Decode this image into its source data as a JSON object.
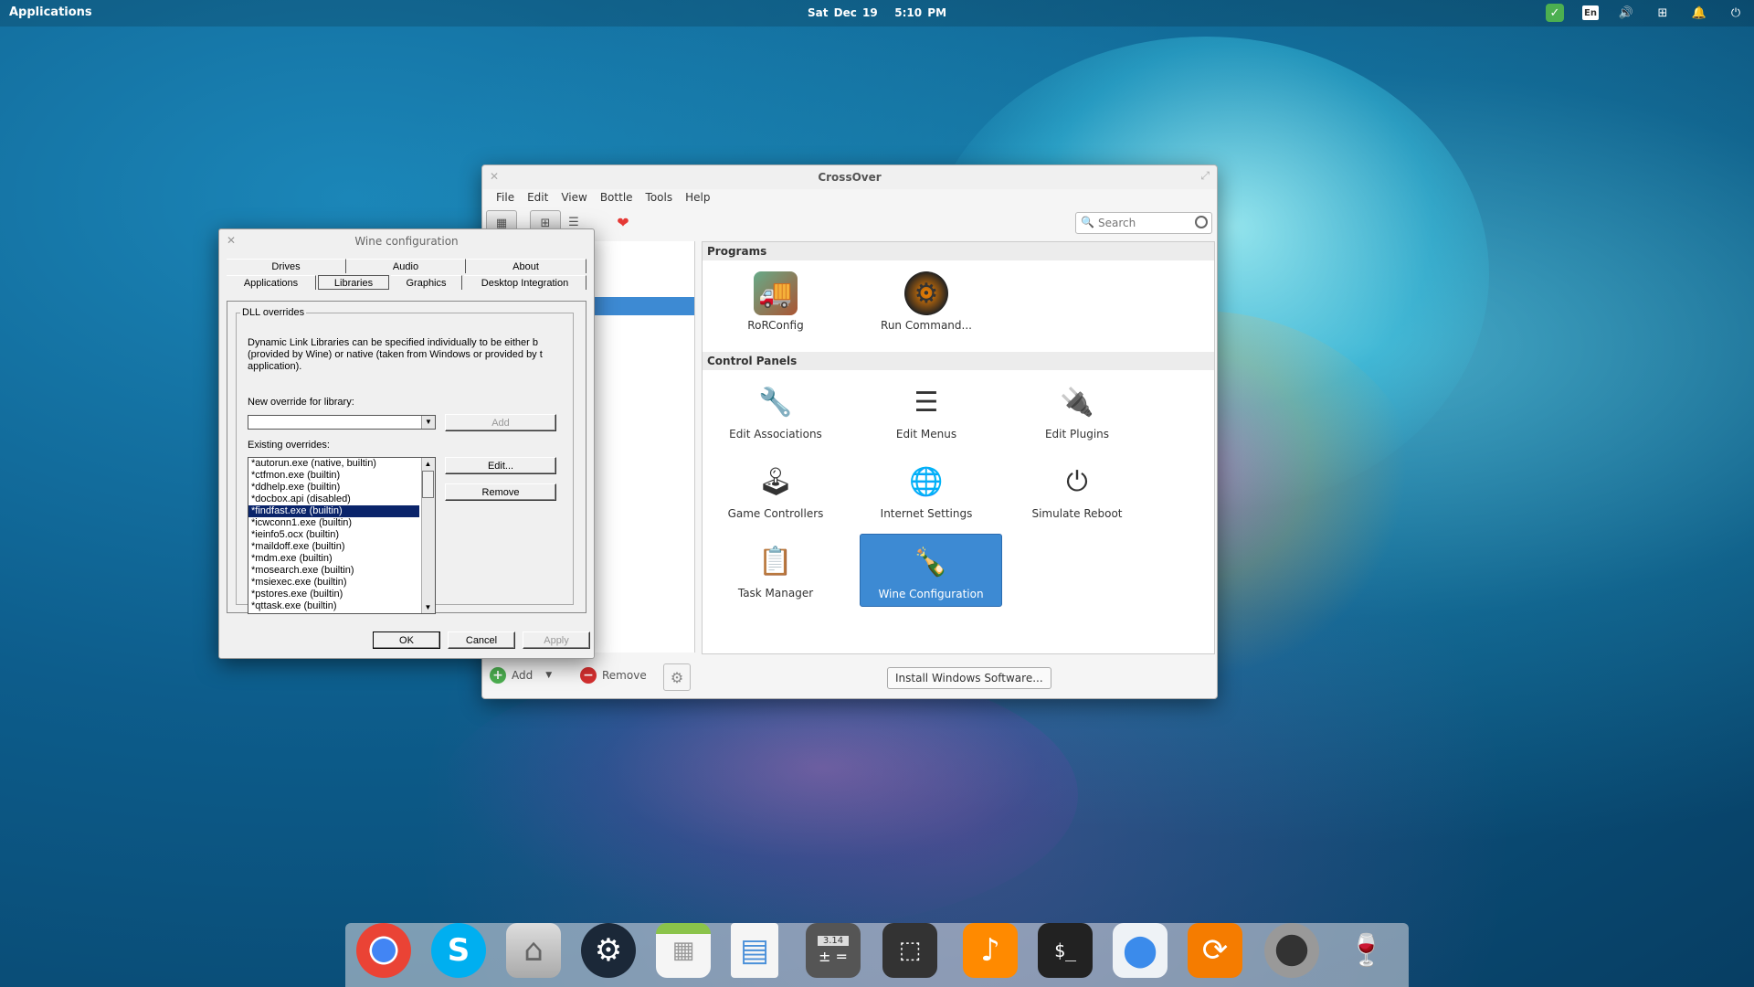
{
  "top_panel": {
    "applications": "Applications",
    "date": "Sat Dec 19",
    "time": "5:10 PM",
    "lang": "En"
  },
  "crossover": {
    "title": "CrossOver",
    "menu": [
      "File",
      "Edit",
      "View",
      "Bottle",
      "Tools",
      "Help"
    ],
    "search_placeholder": "Search",
    "sections": {
      "programs": "Programs",
      "control_panels": "Control Panels"
    },
    "programs": [
      {
        "label": "RoRConfig"
      },
      {
        "label": "Run Command..."
      }
    ],
    "control_panels": [
      {
        "label": "Edit Associations"
      },
      {
        "label": "Edit Menus"
      },
      {
        "label": "Edit Plugins"
      },
      {
        "label": "Game Controllers"
      },
      {
        "label": "Internet Settings"
      },
      {
        "label": "Simulate Reboot"
      },
      {
        "label": "Task Manager"
      },
      {
        "label": "Wine Configuration",
        "selected": true
      }
    ],
    "bottom": {
      "add": "Add",
      "remove": "Remove",
      "install": "Install Windows Software..."
    }
  },
  "winecfg": {
    "title": "Wine configuration",
    "tabs_row1": [
      "Drives",
      "Audio",
      "About"
    ],
    "tabs_row2": [
      "Applications",
      "Libraries",
      "Graphics",
      "Desktop Integration"
    ],
    "active_tab": "Libraries",
    "group_title": "DLL overrides",
    "description": "Dynamic Link Libraries can be specified individually to be either b\n(provided by Wine) or native (taken from Windows or provided by t\napplication).",
    "new_override_label": "New override for library:",
    "existing_label": "Existing overrides:",
    "buttons": {
      "add": "Add",
      "edit": "Edit...",
      "remove": "Remove",
      "ok": "OK",
      "cancel": "Cancel",
      "apply": "Apply"
    },
    "overrides": [
      "*autorun.exe (native, builtin)",
      "*ctfmon.exe (builtin)",
      "*ddhelp.exe (builtin)",
      "*docbox.api (disabled)",
      "*findfast.exe (builtin)",
      "*icwconn1.exe (builtin)",
      "*ieinfo5.ocx (builtin)",
      "*maildoff.exe (builtin)",
      "*mdm.exe (builtin)",
      "*mosearch.exe (builtin)",
      "*msiexec.exe (builtin)",
      "*pstores.exe (builtin)",
      "*qttask.exe (builtin)"
    ],
    "selected_override": "*findfast.exe (builtin)"
  },
  "dock": [
    "chrome-icon",
    "skype-icon",
    "files-icon",
    "steam-icon",
    "calendar-icon",
    "document-icon",
    "calculator-icon",
    "screenshot-icon",
    "music-icon",
    "terminal-icon",
    "switchboard-icon",
    "update-icon",
    "crossover-icon",
    "wine-tools-icon"
  ],
  "calculator_display": "3.14"
}
